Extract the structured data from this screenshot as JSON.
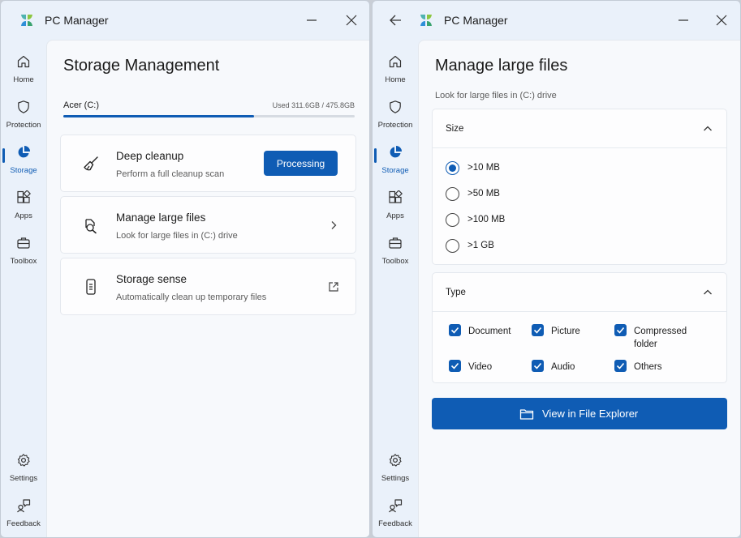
{
  "app": {
    "title": "PC Manager"
  },
  "nav": {
    "home": "Home",
    "protection": "Protection",
    "storage": "Storage",
    "apps": "Apps",
    "toolbox": "Toolbox",
    "settings": "Settings",
    "feedback": "Feedback"
  },
  "storage_window": {
    "page_title": "Storage Management",
    "drive": {
      "name": "Acer (C:)",
      "used_label": "Used 311.6GB / 475.8GB",
      "used_fraction": 0.655
    },
    "cards": [
      {
        "title": "Deep cleanup",
        "subtitle": "Perform a full cleanup scan",
        "button": "Processing",
        "icon": "broom-icon"
      },
      {
        "title": "Manage large files",
        "subtitle": "Look for large files in (C:) drive",
        "icon": "search-document-icon",
        "action_icon": "chevron-right-icon"
      },
      {
        "title": "Storage sense",
        "subtitle": "Automatically clean up temporary files",
        "icon": "phone-storage-icon",
        "action_icon": "external-link-icon"
      }
    ]
  },
  "large_files_window": {
    "page_title": "Manage large files",
    "subtitle": "Look for large files in (C:) drive",
    "size_panel": {
      "label": "Size",
      "options": [
        {
          "label": ">10 MB",
          "selected": true
        },
        {
          "label": ">50 MB",
          "selected": false
        },
        {
          "label": ">100 MB",
          "selected": false
        },
        {
          "label": ">1 GB",
          "selected": false
        }
      ]
    },
    "type_panel": {
      "label": "Type",
      "options": [
        {
          "label": "Document",
          "checked": true
        },
        {
          "label": "Picture",
          "checked": true
        },
        {
          "label": "Compressed folder",
          "checked": true
        },
        {
          "label": "Video",
          "checked": true
        },
        {
          "label": "Audio",
          "checked": true
        },
        {
          "label": "Others",
          "checked": true
        }
      ]
    },
    "view_button": "View in File Explorer"
  },
  "colors": {
    "accent": "#0f5cb4",
    "window_bg": "#eaf1fa",
    "content_bg": "#f7f9fc"
  }
}
